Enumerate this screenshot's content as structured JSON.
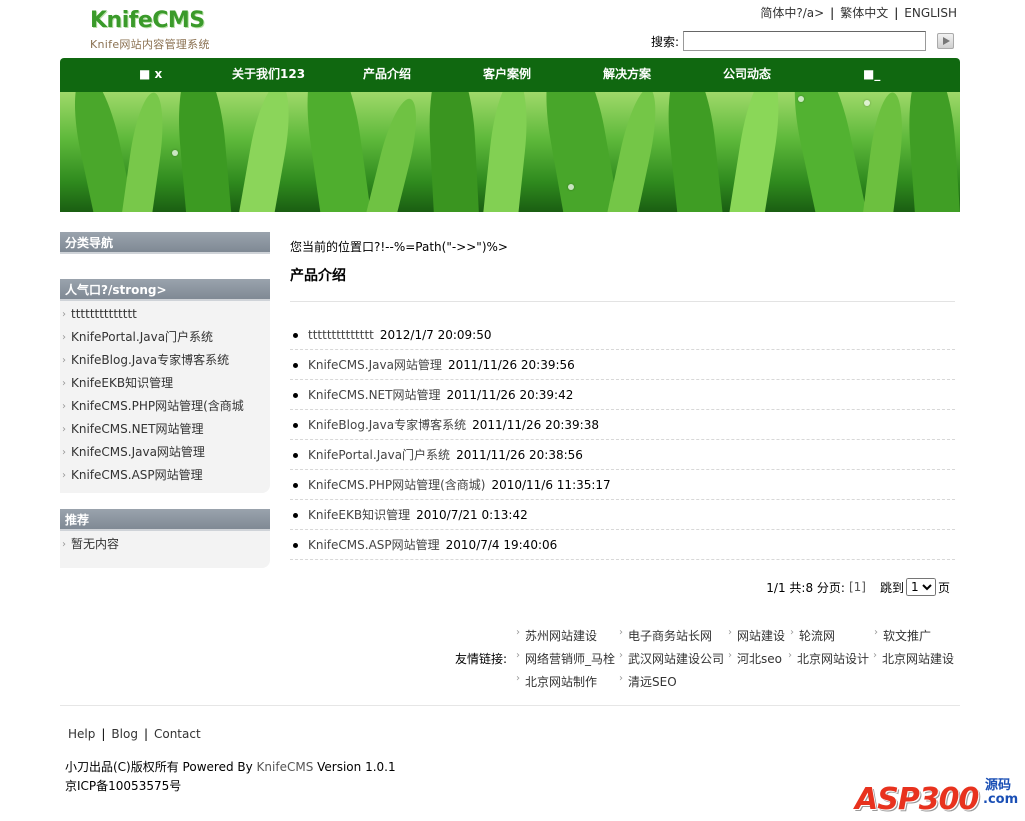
{
  "header": {
    "logo_text": "KnifeCMS",
    "logo_subtitle": "Knife网站内容管理系统",
    "languages": [
      "简体中?/a>",
      "繁体中文",
      "ENGLISH"
    ],
    "search_label": "搜索:",
    "search_value": ""
  },
  "nav": {
    "items": [
      "■ x",
      "关于我们123",
      "产品介绍",
      "客户案例",
      "解决方案",
      "公司动态",
      "■_"
    ]
  },
  "sidebar": {
    "category_title": "分类导航",
    "popular_title": "人气口?/strong>",
    "popular_items": [
      "tttttttttttttt",
      "KnifePortal.Java门户系统",
      "KnifeBlog.Java专家博客系统",
      "KnifeEKB知识管理",
      "KnifeCMS.PHP网站管理(含商城",
      "KnifeCMS.NET网站管理",
      "KnifeCMS.Java网站管理",
      "KnifeCMS.ASP网站管理"
    ],
    "recommend_title": "推荐",
    "recommend_items": [
      "暂无内容"
    ]
  },
  "main": {
    "breadcrumb": "您当前的位置口?!--%=Path(\"->>\")%>",
    "title": "产品介绍",
    "news": [
      {
        "title": "tttttttttttttt",
        "date": "2012/1/7 20:09:50"
      },
      {
        "title": "KnifeCMS.Java网站管理",
        "date": "2011/11/26 20:39:56"
      },
      {
        "title": "KnifeCMS.NET网站管理",
        "date": "2011/11/26 20:39:42"
      },
      {
        "title": "KnifeBlog.Java专家博客系统",
        "date": "2011/11/26 20:39:38"
      },
      {
        "title": "KnifePortal.Java门户系统",
        "date": "2011/11/26 20:38:56"
      },
      {
        "title": "KnifeCMS.PHP网站管理(含商城)",
        "date": "2010/11/6 11:35:17"
      },
      {
        "title": "KnifeEKB知识管理",
        "date": "2010/7/21 0:13:42"
      },
      {
        "title": "KnifeCMS.ASP网站管理",
        "date": "2010/7/4 19:40:06"
      }
    ],
    "pager": {
      "summary": "1/1 共:8 分页:",
      "page_link": "[1]",
      "jump_label": "跳到",
      "selected_page": "1",
      "page_suffix": "页"
    }
  },
  "friend_links": {
    "label": "友情链接:",
    "items": [
      "苏州网站建设",
      "电子商务站长网",
      "网站建设",
      "轮流网",
      "软文推广",
      "网络营销师_马栓",
      "武汉网站建设公司",
      "河北seo",
      "北京网站设计",
      "北京网站建设",
      "北京网站制作",
      "清远SEO"
    ]
  },
  "footer": {
    "links": [
      "Help",
      "Blog",
      "Contact"
    ],
    "copyright_prefix": "小刀出品(C)版权所有 Powered By ",
    "brand": "KnifeCMS",
    "copyright_suffix": " Version 1.0.1",
    "icp": "京ICP备10053575号",
    "watermark": "ASP300",
    "watermark_cn": "源码",
    "watermark_com": ".com"
  }
}
